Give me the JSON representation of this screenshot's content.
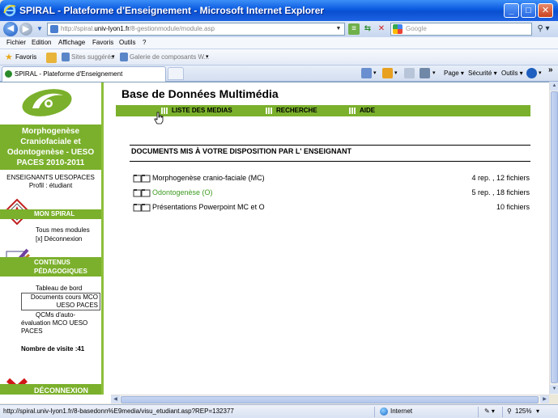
{
  "window": {
    "title": "SPIRAL - Plateforme d'Enseignement - Microsoft Internet Explorer"
  },
  "address": {
    "url_prefix": "http://spiral.",
    "url_host": "univ-lyon1.fr",
    "url_suffix": "/8-gestionmodule/module.asp",
    "search_placeholder": "Google"
  },
  "menu": {
    "items": [
      "Fichier",
      "Edition",
      "Affichage",
      "Favoris",
      "Outils",
      "?"
    ]
  },
  "favorites": {
    "label": "Favoris",
    "items": [
      "Sites suggérés",
      "Galerie de composants W..."
    ]
  },
  "tabs": {
    "active": "SPIRAL - Plateforme d'Enseignement"
  },
  "commands": {
    "page": "Page",
    "security": "Sécurité",
    "tools": "Outils",
    "more": "»"
  },
  "sidebar": {
    "course_title": "Morphogenèse Craniofaciale et Odontogenèse - UESO PACES 2010-2011",
    "teachers": "ENSEIGNANTS UESOPACES",
    "profile": "Profil : étudiant",
    "mon_spiral": {
      "heading": "MON SPIRAL",
      "links": [
        "Tous mes modules",
        "[x] Déconnexion"
      ]
    },
    "contenus": {
      "heading_line1": "CONTENUS",
      "heading_line2": "PÉDAGOGIQUES",
      "links": [
        "Tableau de bord",
        "Documents cours MCO UESO PACES",
        "QCMs d'auto-évaluation MCO UESO PACES"
      ]
    },
    "visits": "Nombre de visite :41",
    "logout": "DÉCONNEXION"
  },
  "main": {
    "title": "Base de Données Multimédia",
    "menu": [
      "LISTE DES MEDIAS",
      "RECHERCHE",
      "AIDE"
    ],
    "section_title": "DOCUMENTS MIS À VOTRE DISPOSITION PAR L' ENSEIGNANT",
    "documents": [
      {
        "name": "Morphogenèse cranio-faciale (MC)",
        "count": "4 rep. , 12 fichiers"
      },
      {
        "name": "Odontogenèse (O)",
        "count": "5 rep. , 18 fichiers"
      },
      {
        "name": "Présentations Powerpoint MC et O",
        "count": "10 fichiers"
      }
    ]
  },
  "status": {
    "url": "http://spiral.univ-lyon1.fr/8-basedonn%E9media/visu_etudiant.asp?REP=132377",
    "zone": "Internet",
    "zoom": "125%"
  },
  "colors": {
    "accent_green": "#7bb02c",
    "active_link": "#3b9a1f",
    "xp_blue": "#0a5adf"
  }
}
